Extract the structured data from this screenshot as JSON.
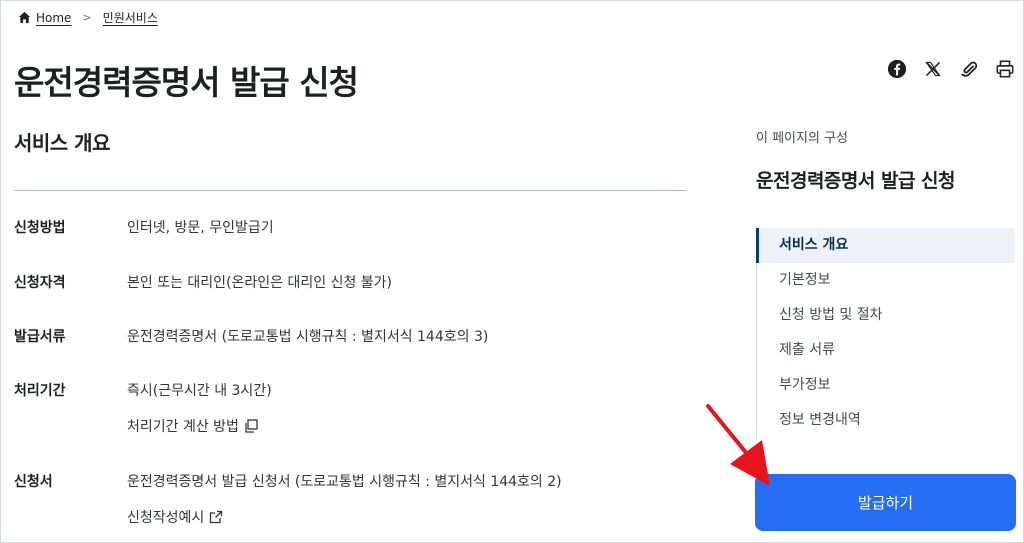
{
  "breadcrumb": {
    "home": "Home",
    "current": "민원서비스"
  },
  "page": {
    "title": "운전경력증명서 발급 신청"
  },
  "share": {
    "icons": [
      "facebook-icon",
      "x-icon",
      "link-icon",
      "print-icon"
    ]
  },
  "overview": {
    "title": "서비스 개요",
    "rows": [
      {
        "label": "신청방법",
        "value": "인터넷, 방문, 무인발급기"
      },
      {
        "label": "신청자격",
        "value": "본인 또는 대리인(온라인은 대리인 신청 불가)"
      },
      {
        "label": "발급서류",
        "value": "운전경력증명서 (도로교통법 시행규칙 : 별지서식 144호의 3)"
      },
      {
        "label": "처리기간",
        "value": "즉시(근무시간 내 3시간)"
      },
      {
        "label": "신청서",
        "value": "운전경력증명서 발급 신청서 (도로교통법 시행규칙 : 별지서식 144호의 2)"
      }
    ],
    "processing_link": "처리기간 계산 방법",
    "form_example_link": "신청작성예시"
  },
  "toc": {
    "caption": "이 페이지의 구성",
    "title": "운전경력증명서 발급 신청",
    "items": [
      "서비스 개요",
      "기본정보",
      "신청 방법 및 절차",
      "제출 서류",
      "부가정보",
      "정보 변경내역"
    ],
    "active_index": 0
  },
  "cta": {
    "label": "발급하기"
  },
  "colors": {
    "primary": "#256ef4",
    "toc_active": "#0b3a75",
    "annotation": "#e8141b"
  }
}
